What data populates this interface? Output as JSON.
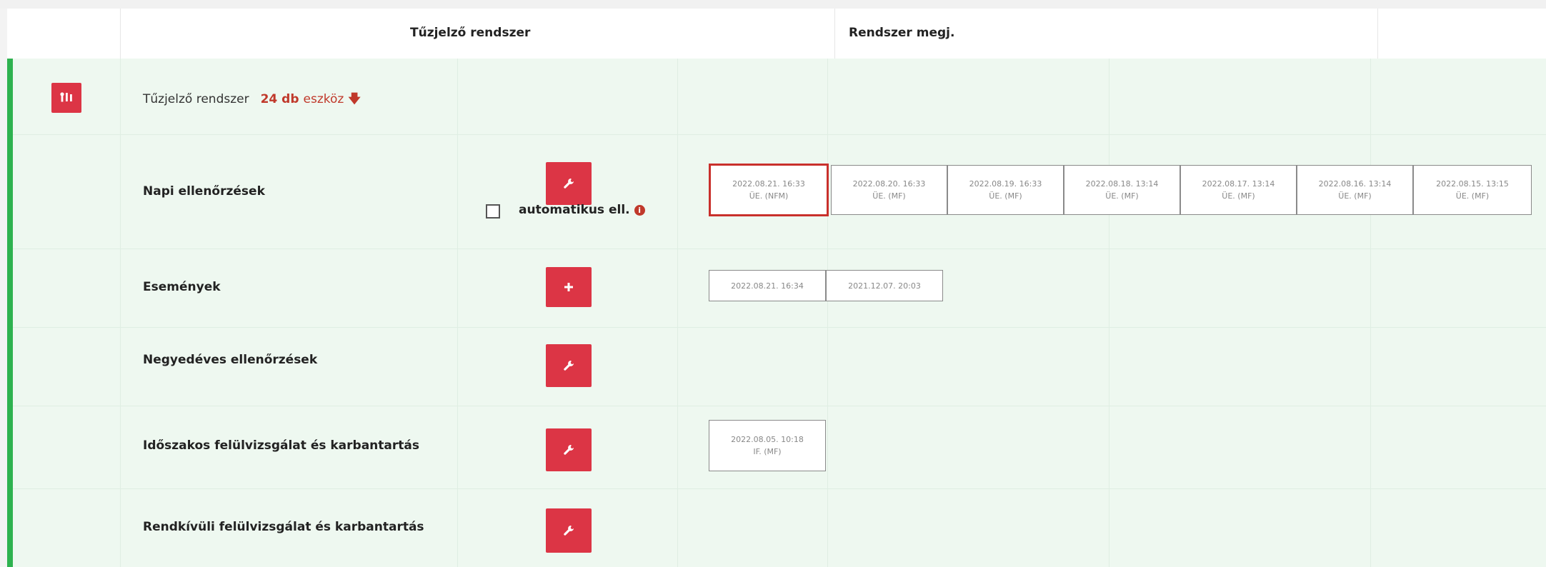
{
  "header": {
    "system_col": "Tűzjelző rendszer",
    "note_col": "Rendszer megj."
  },
  "system": {
    "name": "Tűzjelző rendszer",
    "count": "24 db",
    "count_word": "eszköz",
    "expand_icon": "arrow-down-icon",
    "icon": "tools-icon"
  },
  "rows": [
    {
      "title": "Napi ellenőrzések",
      "action_icon": "wrench-icon",
      "auto_check_label": "automatikus ell.",
      "dates": [
        {
          "date": "2022.08.21. 16:33",
          "code": "ÜE. (NFM)"
        },
        {
          "date": "2022.08.20. 16:33",
          "code": "ÜE. (MF)"
        },
        {
          "date": "2022.08.19. 16:33",
          "code": "ÜE. (MF)"
        },
        {
          "date": "2022.08.18. 13:14",
          "code": "ÜE. (MF)"
        },
        {
          "date": "2022.08.17. 13:14",
          "code": "ÜE. (MF)"
        },
        {
          "date": "2022.08.16. 13:14",
          "code": "ÜE. (MF)"
        },
        {
          "date": "2022.08.15. 13:15",
          "code": "ÜE. (MF)"
        }
      ]
    },
    {
      "title": "Események",
      "action_icon": "plus-icon",
      "dates": [
        {
          "date": "2022.08.21. 16:34"
        },
        {
          "date": "2021.12.07. 20:03"
        }
      ]
    },
    {
      "title": "Negyedéves ellenőrzések",
      "action_icon": "wrench-icon"
    },
    {
      "title": "Időszakos felülvizsgálat és karbantartás",
      "action_icon": "wrench-icon",
      "dates": [
        {
          "date": "2022.08.05. 10:18",
          "code": "IF. (MF)"
        }
      ]
    },
    {
      "title": "Rendkívüli felülvizsgálat és karbantartás",
      "action_icon": "wrench-icon"
    }
  ],
  "colors": {
    "accent_red": "#dc3545",
    "green_bar": "#2eb24f",
    "row_bg": "#eef8f0"
  }
}
